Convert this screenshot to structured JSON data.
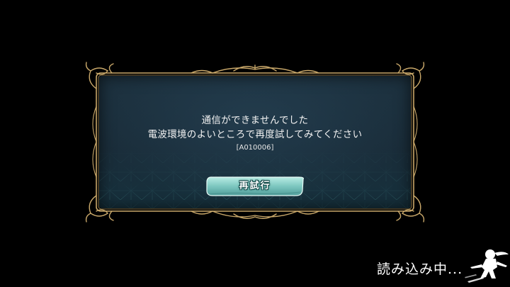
{
  "dialog": {
    "message_line1": "通信ができませんでした",
    "message_line2": "電波環境のよいところで再度試してみてください",
    "error_code": "[A010006]",
    "retry_label": "再試行"
  },
  "loading": {
    "text": "読み込み中..."
  },
  "icons": {
    "ornament": "gold-frame-ornament",
    "loading_figure": "ninja-silhouette-icon"
  },
  "colors": {
    "background": "#000000",
    "dialog_bg": "#1b2f3c",
    "frame_gold": "#c9a86a",
    "button_teal": "#8ccfc9",
    "text": "#f2f2f2"
  }
}
